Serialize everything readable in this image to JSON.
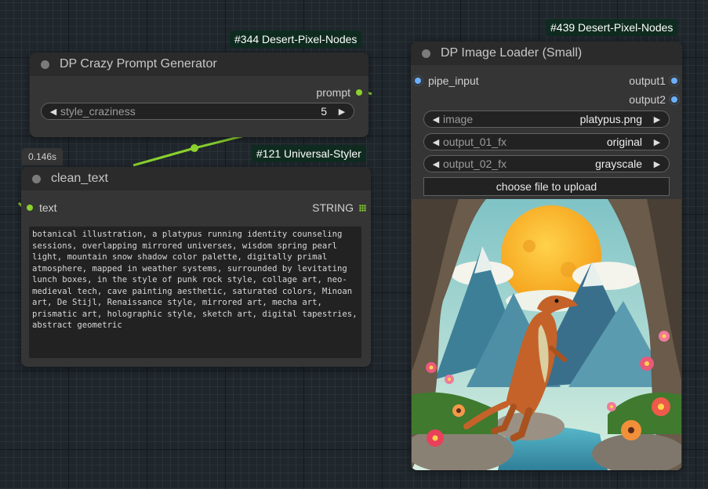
{
  "colors": {
    "canvas_bg": "#1f262c",
    "node_bg": "#353535",
    "badge_bg": "#0f2b20",
    "link_green": "#8bd12e",
    "socket_blue": "#6ab0ff"
  },
  "prompt_node": {
    "badge": "#344 Desert-Pixel-Nodes",
    "title": "DP Crazy Prompt Generator",
    "output_label": "prompt",
    "widget": {
      "label": "style_craziness",
      "value": "5"
    }
  },
  "clean_text_node": {
    "timing": "0.146s",
    "badge": "#121 Universal-Styler",
    "title": "clean_text",
    "input_label": "text",
    "output_type": "STRING",
    "text": "botanical illustration, a platypus running identity counseling sessions, overlapping mirrored universes, wisdom spring pearl light, mountain snow shadow color palette, digitally primal atmosphere, mapped in weather systems, surrounded by levitating lunch boxes, in the style of punk rock style, collage art, neo-medieval tech, cave painting aesthetic, saturated colors, Minoan art, De Stijl, Renaissance style, mirrored art, mecha art, prismatic art, holographic style, sketch art, digital tapestries, abstract geometric"
  },
  "loader_node": {
    "badge": "#439 Desert-Pixel-Nodes",
    "title": "DP Image Loader (Small)",
    "input_label": "pipe_input",
    "outputs": [
      "output1",
      "output2"
    ],
    "widgets": [
      {
        "label": "image",
        "value": "platypus.png"
      },
      {
        "label": "output_01_fx",
        "value": "original"
      },
      {
        "label": "output_02_fx",
        "value": "grayscale"
      }
    ],
    "upload_button": "choose file to upload",
    "preview_icon": "platypus-painting-image"
  }
}
